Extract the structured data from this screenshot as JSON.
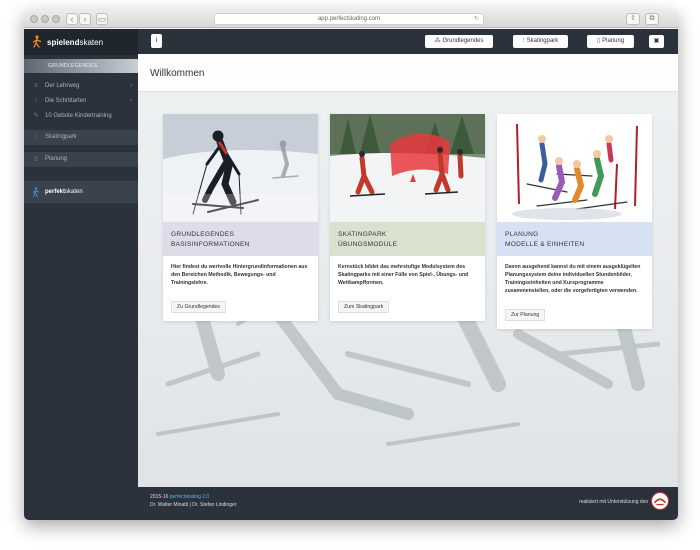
{
  "browser": {
    "url": "app.perfectskating.com"
  },
  "sidebar": {
    "logo_bold": "spielend",
    "logo_light": "skaten",
    "active_item": "GRUNDLEGENDES",
    "items": [
      {
        "label": "Der Lehrweg"
      },
      {
        "label": "Die Schrittarten"
      },
      {
        "label": "10 Gebote Kindertraining"
      }
    ],
    "skatingpark": "Skatingpark",
    "planung": "Planung",
    "brand_bold": "perfekt",
    "brand_light": "skaten"
  },
  "topbar": {
    "menu_label": "i",
    "btn_grundlegendes": "Grundlegendes",
    "btn_skatingpark": "Skatingpark",
    "btn_planung": "Planung",
    "btn_last": "▣"
  },
  "main": {
    "title": "Willkommen"
  },
  "cards": [
    {
      "head1": "GRUNDLEGENDES",
      "head2": "BASISINFORMATIONEN",
      "body": "Hier findest du wertvolle Hintergrundinformationen aus den Bereichen Methodik, Bewegungs- und Trainingslehre.",
      "button": "Zu Grundlegendes"
    },
    {
      "head1": "SKATINGPARK",
      "head2": "ÜBUNGSMODULE",
      "body": "Kernstück bildet das mehrstufige Modulsystem des Skatingparks mit einer Fülle von Spiel-, Übungs- und Wettkampfformen.",
      "button": "Zum Skatingpark"
    },
    {
      "head1": "PLANUNG",
      "head2": "MODELLE & EINHEITEN",
      "body": "Davon ausgehend kannst du mit einem ausgeklügelten Planungssystem deine individuellen Stundenbilder, Trainingseinheiten und Kursprogramme zusammenstellen, oder die vorgefertigten verwenden.",
      "button": "Zur Planung"
    }
  ],
  "footer": {
    "year": "2015-16",
    "brand": "perfectskating 2.0",
    "authors": "Dr. Walter Minatti | Dr. Stefan Lindinger",
    "support": "realisiert mit Unterstützung des"
  },
  "colors": {
    "dark": "#2b323c",
    "card1_tint": "#dcdde9",
    "card2_tint": "#d9e2cf",
    "card3_tint": "#d6e2f4",
    "accent_blue": "#5fb0e6"
  }
}
